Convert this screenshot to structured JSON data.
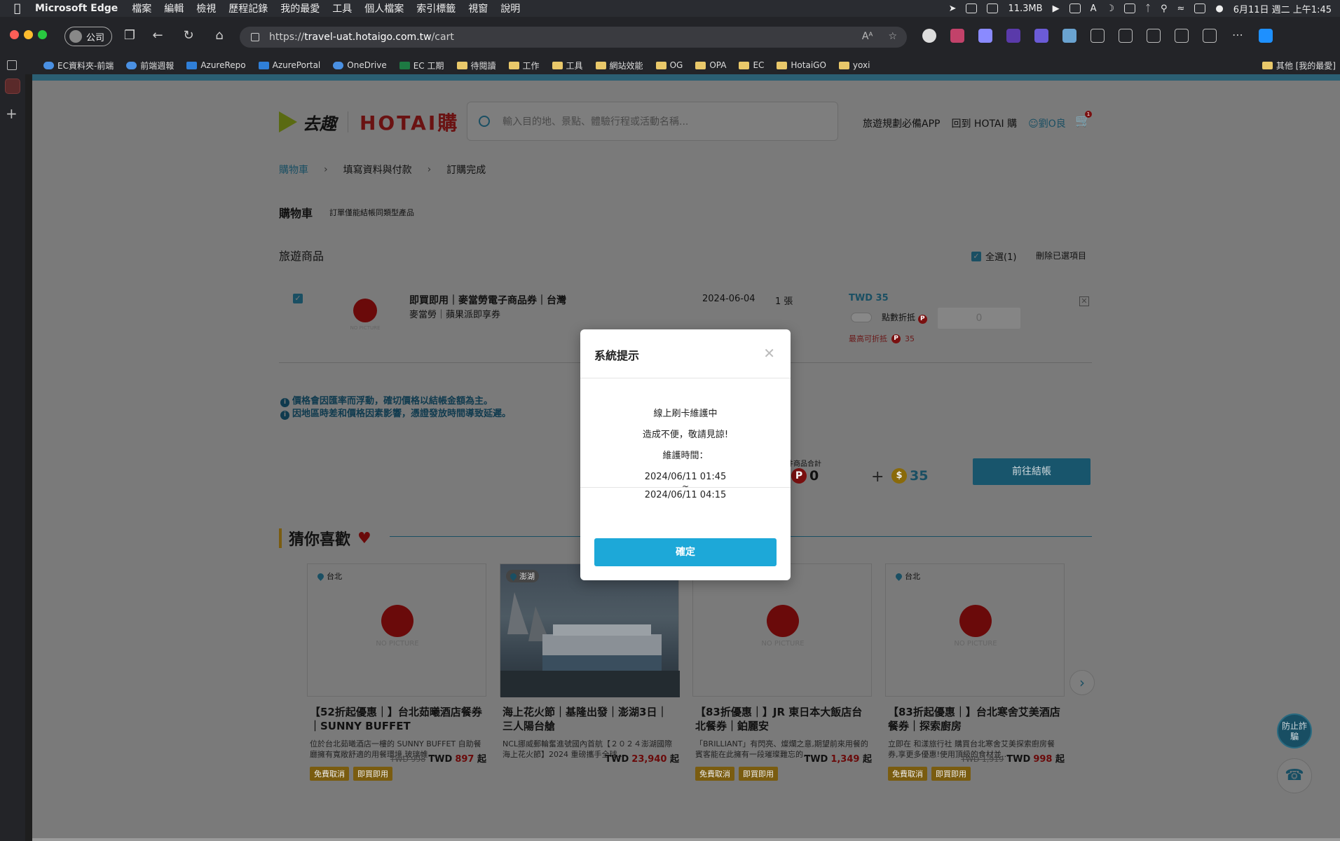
{
  "menubar": {
    "app": "Microsoft Edge",
    "items": [
      "檔案",
      "編輯",
      "檢視",
      "歷程記錄",
      "我的最愛",
      "工具",
      "個人檔案",
      "索引標籤",
      "視窗",
      "說明"
    ],
    "network": "11.3MB",
    "datetime": "6月11日 週二 上午1:45"
  },
  "browser": {
    "profile": "公司",
    "url_scheme": "https://",
    "url_host": "travel-uat.hotaigo.com.tw",
    "url_path": "/cart",
    "read_aloud": "Aᴬ"
  },
  "bookmarks": [
    {
      "label": "EC資料夾-前端",
      "icon": "cloud"
    },
    {
      "label": "前端週報",
      "icon": "cloud"
    },
    {
      "label": "AzureRepo",
      "icon": "azure"
    },
    {
      "label": "AzurePortal",
      "icon": "azure"
    },
    {
      "label": "OneDrive",
      "icon": "cloud"
    },
    {
      "label": "EC 工期",
      "icon": "excel"
    },
    {
      "label": "待閱讀",
      "icon": "folder"
    },
    {
      "label": "工作",
      "icon": "folder"
    },
    {
      "label": "工具",
      "icon": "folder"
    },
    {
      "label": "網站效能",
      "icon": "folder"
    },
    {
      "label": "OG",
      "icon": "folder"
    },
    {
      "label": "OPA",
      "icon": "folder"
    },
    {
      "label": "EC",
      "icon": "folder"
    },
    {
      "label": "HotaiGO",
      "icon": "folder"
    },
    {
      "label": "yoxi",
      "icon": "folder"
    }
  ],
  "bookmarks_other": "其他 [我的最愛]",
  "header": {
    "logo_text": "去趣",
    "brand": "HOTAI購",
    "search_placeholder": "輸入目的地、景點、體驗行程或活動名稱...",
    "app_link": "旅遊規劃必備APP",
    "back_link": "回到 HOTAI 購",
    "user": "劉O良",
    "cart_count": "1"
  },
  "breadcrumb": [
    "購物車",
    "填寫資料與付款",
    "訂購完成"
  ],
  "cart": {
    "title": "購物車",
    "note": "訂單僅能結帳同類型產品",
    "section": "旅遊商品",
    "select_all": "全選(1)",
    "delete_selected": "刪除已選項目",
    "item": {
      "name": "即買即用｜麥當勞電子商品券｜台灣",
      "sub": "麥當勞｜蘋果派即享券",
      "date": "2024-06-04",
      "qty": "1 張",
      "price": "TWD 35",
      "points_label": "點數折抵",
      "points_value": "0",
      "max_label": "最高可折抵",
      "max_value": "35",
      "no_picture": "NO PICTURE"
    },
    "notices": [
      "價格會因匯率而浮動，確切價格以結帳金額為主。",
      "因地區時差和價格因素影響，憑證發放時間導致延遲。"
    ],
    "summary_label": "件商品合計",
    "summary_points": "0",
    "summary_cash": "35",
    "checkout": "前往結帳"
  },
  "recommend": {
    "title": "猜你喜歡",
    "cards": [
      {
        "loc": "台北",
        "title": "【52折起優惠｜】台北茹曦酒店餐券｜SUNNY BUFFET",
        "desc": "位於台北茹曦酒店一樓的 SUNNY BUFFET 自助餐廳擁有寬敞舒適的用餐環境,玻璃帷…",
        "tags": [
          "免費取消",
          "即買即用"
        ],
        "old": "TWD 998",
        "cur": "TWD",
        "price": "897",
        "suffix": "起",
        "photo": false
      },
      {
        "loc": "澎湖",
        "title": "海上花火節｜基隆出發｜澎湖3日｜三人陽台艙",
        "desc": "NCL挪威郵輪奮進號國內首航【２０２４澎湖國際海上花火節】2024 重磅攜手全球…",
        "tags": [],
        "old": "",
        "cur": "TWD",
        "price": "23,940",
        "suffix": "起",
        "photo": true
      },
      {
        "loc": "",
        "title": "【83折優惠｜】JR 東日本大飯店台北餐券｜鉑麗安",
        "desc": "「BRILLIANT」有閃亮、燦爛之意,期望前來用餐的賓客能在此擁有一段璀璨難忘的…",
        "tags": [
          "免費取消",
          "即買即用"
        ],
        "old": "",
        "cur": "TWD",
        "price": "1,349",
        "suffix": "起",
        "photo": false
      },
      {
        "loc": "台北",
        "title": "【83折起優惠｜】台北寒舍艾美酒店餐券｜探索廚房",
        "desc": "立即在 和漾旅行社 購買台北寒舍艾美探索廚房餐券,享更多優惠!使用頂級的食材並…",
        "tags": [
          "免費取消",
          "即買即用"
        ],
        "old": "TWD 1,919",
        "cur": "TWD",
        "price": "998",
        "suffix": "起",
        "photo": false
      }
    ]
  },
  "fraud_btn": "防止詐騙",
  "modal": {
    "title": "系統提示",
    "line1": "線上刷卡維護中",
    "line2": "造成不便，敬請見諒!",
    "line3": "維護時間：",
    "start": "2024/06/11 01:45",
    "tilde": "~",
    "end": "2024/06/11 04:15",
    "ok": "確定"
  },
  "colors": {
    "accent": "#1da8d8",
    "brand_dark": "#1a4f63",
    "overlay_gray": "#7a7a7a"
  }
}
